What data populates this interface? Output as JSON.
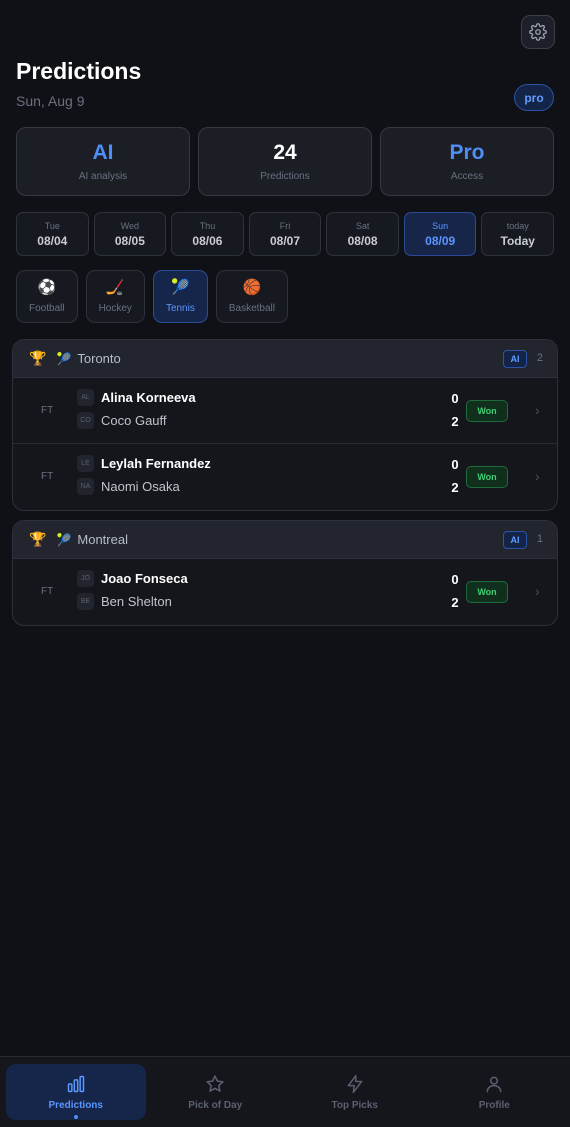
{
  "header": {
    "title": "Predictions",
    "date": "Sun, Aug 9",
    "badge": "pro"
  },
  "stats": [
    {
      "value": "AI",
      "label": "AI analysis"
    },
    {
      "value": "24",
      "label": "Predictions"
    },
    {
      "value": "Pro",
      "label": "Access"
    }
  ],
  "dates": [
    {
      "day": "Tue",
      "date": "08/04"
    },
    {
      "day": "Wed",
      "date": "08/05"
    },
    {
      "day": "Thu",
      "date": "08/06"
    },
    {
      "day": "Fri",
      "date": "08/07"
    },
    {
      "day": "Sat",
      "date": "08/08"
    },
    {
      "day": "Sun",
      "date": "08/09"
    },
    {
      "day": "today",
      "date": "Today"
    }
  ],
  "sports": [
    {
      "icon": "⚽",
      "label": "Football"
    },
    {
      "icon": "🏒",
      "label": "Hockey"
    },
    {
      "icon": "🎾",
      "label": "Tennis"
    },
    {
      "icon": "🏀",
      "label": "Basketball"
    }
  ],
  "leagues": [
    {
      "name": "Toronto",
      "ai": "AI",
      "count": "2",
      "matches": [
        {
          "status": "FT",
          "p1_initials": "AL",
          "p1": "Alina Korneeva",
          "s1": "0",
          "p2_initials": "CO",
          "p2": "Coco Gauff",
          "s2": "2",
          "result": "Won"
        },
        {
          "status": "FT",
          "p1_initials": "LE",
          "p1": "Leylah Fernandez",
          "s1": "0",
          "p2_initials": "NA",
          "p2": "Naomi Osaka",
          "s2": "2",
          "result": "Won"
        }
      ]
    },
    {
      "name": "Montreal",
      "ai": "AI",
      "count": "1",
      "matches": [
        {
          "status": "FT",
          "p1_initials": "JO",
          "p1": "Joao Fonseca",
          "s1": "0",
          "p2_initials": "BE",
          "p2": "Ben Shelton",
          "s2": "2",
          "result": "Won"
        }
      ]
    }
  ],
  "nav": [
    {
      "label": "Predictions",
      "icon": "bar-chart-icon"
    },
    {
      "label": "Pick of Day",
      "icon": "star-icon"
    },
    {
      "label": "Top Picks",
      "icon": "lightning-icon"
    },
    {
      "label": "Profile",
      "icon": "user-icon"
    }
  ],
  "colors": {
    "accent": "#4f8ef7",
    "won": "#3fcf74",
    "background": "#0f1116"
  }
}
